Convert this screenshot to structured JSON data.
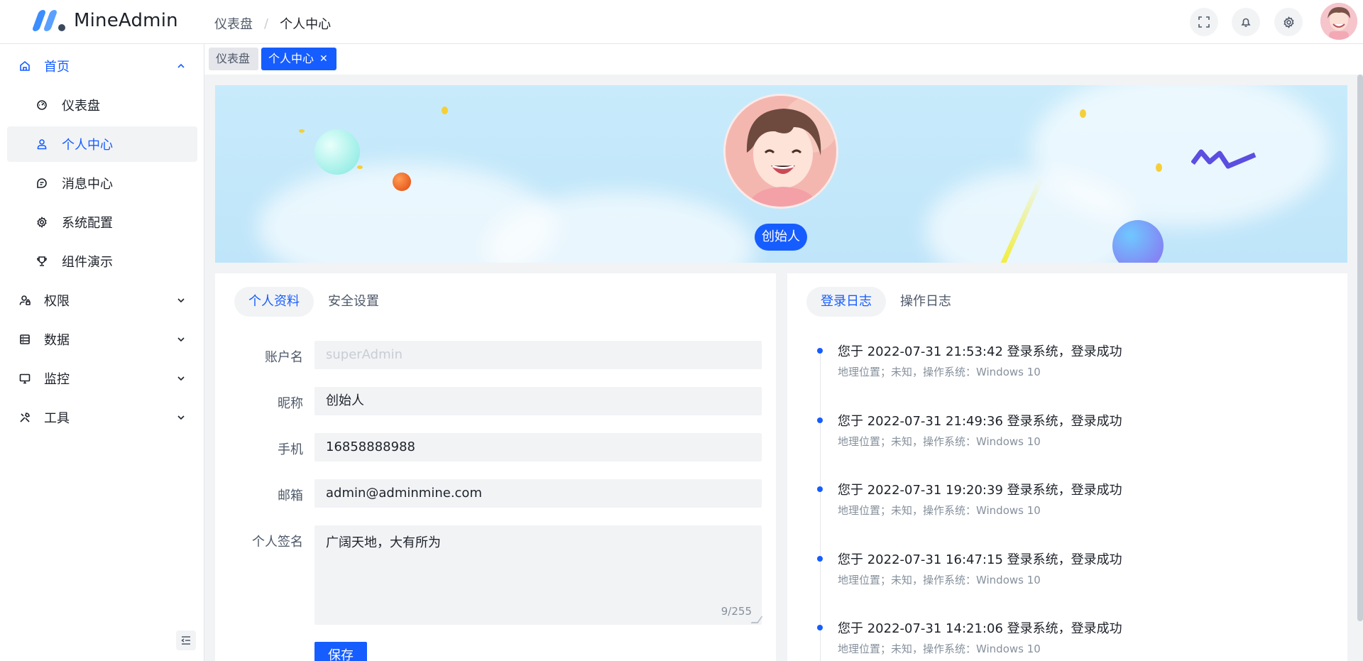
{
  "app": {
    "name": "MineAdmin"
  },
  "breadcrumb": [
    "仪表盘",
    "个人中心"
  ],
  "header": {
    "icons": [
      "fullscreen-icon",
      "bell-icon",
      "gear-icon"
    ]
  },
  "sidebar": {
    "items": [
      {
        "label": "首页",
        "icon": "home-icon",
        "expanded": true
      },
      {
        "label": "仪表盘",
        "icon": "dashboard-icon"
      },
      {
        "label": "个人中心",
        "icon": "user-icon",
        "active": true
      },
      {
        "label": "消息中心",
        "icon": "message-icon"
      },
      {
        "label": "系统配置",
        "icon": "gear-icon"
      },
      {
        "label": "组件演示",
        "icon": "trophy-icon"
      },
      {
        "label": "权限",
        "icon": "user-lock-icon"
      },
      {
        "label": "数据",
        "icon": "database-icon"
      },
      {
        "label": "监控",
        "icon": "monitor-icon"
      },
      {
        "label": "工具",
        "icon": "tools-icon"
      }
    ]
  },
  "tabs": [
    {
      "label": "仪表盘",
      "active": false
    },
    {
      "label": "个人中心",
      "active": true,
      "close": "✕"
    }
  ],
  "profile": {
    "role": "创始人"
  },
  "left_panel": {
    "tabs": [
      "个人资料",
      "安全设置"
    ],
    "form": {
      "account_label": "账户名",
      "account_value": "superAdmin",
      "nickname_label": "昵称",
      "nickname_value": "创始人",
      "phone_label": "手机",
      "phone_value": "16858888988",
      "email_label": "邮箱",
      "email_value": "admin@adminmine.com",
      "signature_label": "个人签名",
      "signature_value": "广阔天地，大有所为",
      "signature_count": "9/255",
      "save_label": "保存"
    }
  },
  "right_panel": {
    "tabs": [
      "登录日志",
      "操作日志"
    ],
    "logs": [
      {
        "title": "您于 2022-07-31 21:53:42 登录系统，登录成功",
        "sub": "地理位置；未知，操作系统：Windows 10"
      },
      {
        "title": "您于 2022-07-31 21:49:36 登录系统，登录成功",
        "sub": "地理位置；未知，操作系统：Windows 10"
      },
      {
        "title": "您于 2022-07-31 19:20:39 登录系统，登录成功",
        "sub": "地理位置；未知，操作系统：Windows 10"
      },
      {
        "title": "您于 2022-07-31 16:47:15 登录系统，登录成功",
        "sub": "地理位置；未知，操作系统：Windows 10"
      },
      {
        "title": "您于 2022-07-31 14:21:06 登录系统，登录成功",
        "sub": "地理位置；未知，操作系统：Windows 10"
      }
    ]
  },
  "colors": {
    "primary": "#165dff",
    "banner": "#c8ebfb"
  }
}
